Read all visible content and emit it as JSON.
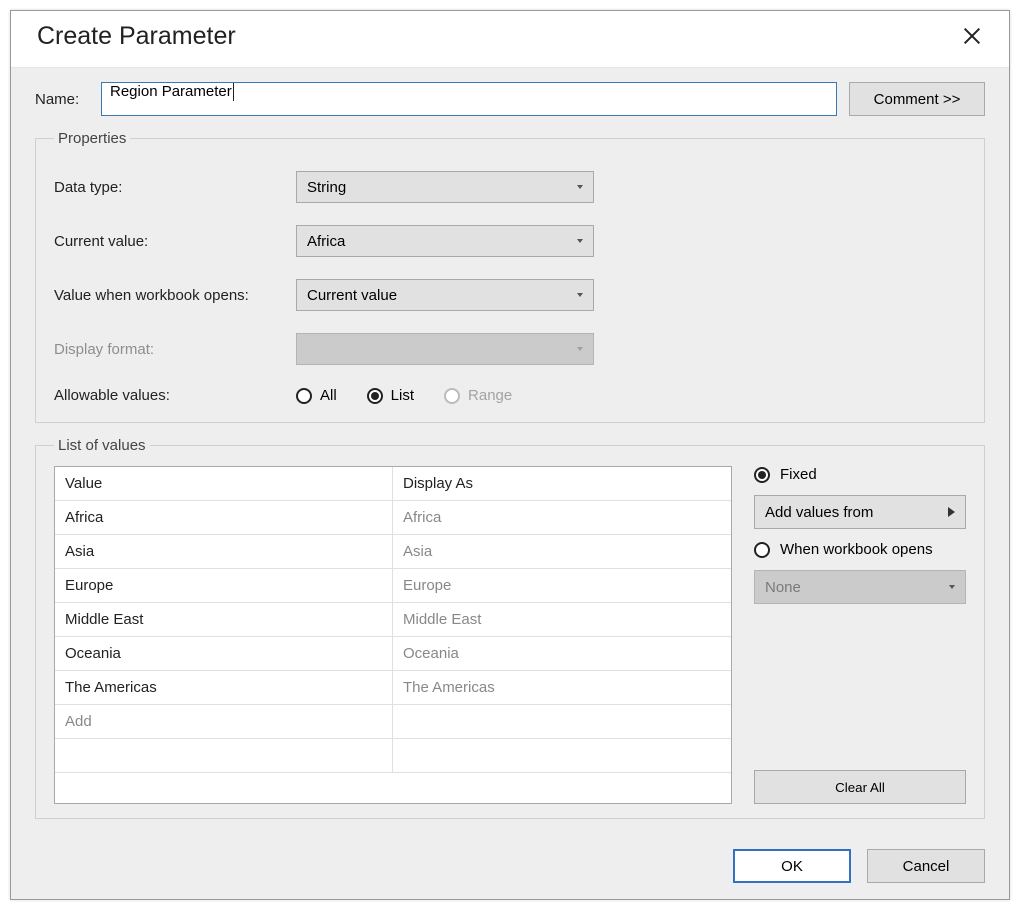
{
  "dialog": {
    "title": "Create Parameter",
    "name_label": "Name:",
    "name_value": "Region Parameter",
    "comment_btn": "Comment >>"
  },
  "properties": {
    "legend": "Properties",
    "data_type_label": "Data type:",
    "data_type_value": "String",
    "current_value_label": "Current value:",
    "current_value_value": "Africa",
    "open_value_label": "Value when workbook opens:",
    "open_value_value": "Current value",
    "display_format_label": "Display format:",
    "allowable_label": "Allowable values:",
    "radio_all": "All",
    "radio_list": "List",
    "radio_range": "Range",
    "selected_allowable": "List"
  },
  "list": {
    "legend": "List of values",
    "col_value": "Value",
    "col_display": "Display As",
    "rows": [
      {
        "value": "Africa",
        "display": "Africa"
      },
      {
        "value": "Asia",
        "display": "Asia"
      },
      {
        "value": "Europe",
        "display": "Europe"
      },
      {
        "value": "Middle East",
        "display": "Middle East"
      },
      {
        "value": "Oceania",
        "display": "Oceania"
      },
      {
        "value": "The Americas",
        "display": "The Americas"
      }
    ],
    "add_label": "Add",
    "side": {
      "fixed": "Fixed",
      "add_values_from": "Add values from",
      "when_open": "When workbook opens",
      "none": "None",
      "clear_all": "Clear All",
      "selected": "Fixed"
    }
  },
  "footer": {
    "ok": "OK",
    "cancel": "Cancel"
  }
}
